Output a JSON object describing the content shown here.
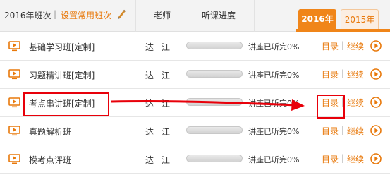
{
  "header": {
    "year_label": "2016年班次",
    "separator": "|",
    "set_common": "设置常用班次",
    "teacher_col": "老师",
    "progress_col": "听课进度",
    "tabs": [
      {
        "label": "2016年",
        "active": true
      },
      {
        "label": "2015年",
        "active": false
      }
    ]
  },
  "rows": [
    {
      "name": "基础学习班[定制]",
      "teacher": "达江",
      "progress": 0,
      "status": "讲座已听完0%",
      "catalog": "目录",
      "sep": "|",
      "continue": "继续"
    },
    {
      "name": "习题精讲班[定制]",
      "teacher": "达江",
      "progress": 0,
      "status": "讲座已听完0%",
      "catalog": "目录",
      "sep": "|",
      "continue": "继续"
    },
    {
      "name": "考点串讲班[定制]",
      "teacher": "达江",
      "progress": 0,
      "status": "讲座已听完0%",
      "catalog": "目录",
      "sep": "|",
      "continue": "继续"
    },
    {
      "name": "真题解析班",
      "teacher": "达江",
      "progress": 0,
      "status": "讲座已听完0%",
      "catalog": "目录",
      "sep": "|",
      "continue": "继续"
    },
    {
      "name": "模考点评班",
      "teacher": "达江",
      "progress": 0,
      "status": "讲座已听完0%",
      "catalog": "目录",
      "sep": "|",
      "continue": "继续"
    }
  ],
  "icons": {
    "course": "video-lecture-icon",
    "play": "play-circle-icon",
    "edit": "pencil-icon"
  },
  "colors": {
    "accent": "#f08519",
    "link": "#e8780a",
    "annotation": "#e8000a"
  }
}
